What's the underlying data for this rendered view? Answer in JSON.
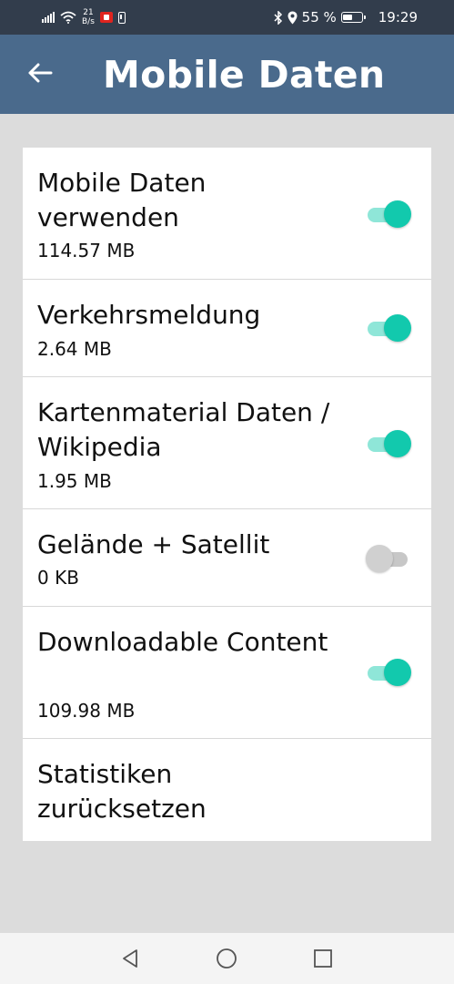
{
  "status_bar": {
    "speed_value": "21",
    "speed_unit": "B/s",
    "battery_percent": "55 %",
    "battery_level": 0.55,
    "time": "19:29",
    "icons": [
      "signal-icon",
      "wifi-icon",
      "notification-icon",
      "battery-notification-icon",
      "bluetooth-icon",
      "location-icon",
      "battery-icon"
    ]
  },
  "app_bar": {
    "title": "Mobile Daten",
    "back_icon": "arrow-left-icon"
  },
  "settings": [
    {
      "title": "Mobile Daten verwenden",
      "subtitle": "114.57 MB",
      "toggle": true
    },
    {
      "title": "Verkehrsmeldung",
      "subtitle": "2.64 MB",
      "toggle": true
    },
    {
      "title": "Kartenmaterial Daten / Wikipedia",
      "subtitle": "1.95 MB",
      "toggle": true
    },
    {
      "title": "Gelände + Satellit",
      "subtitle": "0 KB",
      "toggle": false
    },
    {
      "title": "Downloadable Content",
      "subtitle": "109.98 MB",
      "toggle": true
    },
    {
      "title": "Statistiken zurücksetzen"
    }
  ],
  "colors": {
    "status_bar": "#323d4c",
    "app_bar": "#4a6a8c",
    "background": "#dcdcdc",
    "toggle_on_knob": "#12c9ad",
    "toggle_on_track": "#8fe6d8",
    "toggle_off_knob": "#d0d0d0"
  },
  "nav_bar": {
    "icons": [
      "back-triangle-icon",
      "home-circle-icon",
      "recents-square-icon"
    ]
  }
}
